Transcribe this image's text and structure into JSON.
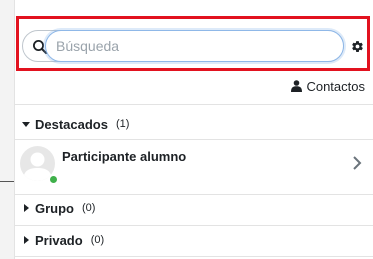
{
  "search": {
    "placeholder": "Búsqueda",
    "value": ""
  },
  "contacts_link": {
    "label": "Contactos",
    "icon": "user-icon"
  },
  "sections": [
    {
      "label": "Destacados",
      "count": "(1)",
      "expanded": true
    },
    {
      "label": "Grupo",
      "count": "(0)",
      "expanded": false
    },
    {
      "label": "Privado",
      "count": "(0)",
      "expanded": false
    }
  ],
  "starred_contacts": [
    {
      "name": "Participante alumno",
      "status": "online"
    }
  ],
  "colors": {
    "highlight": "#e2121f",
    "online": "#3fb04a",
    "focus_border": "#8fb8e8"
  },
  "icons": [
    "search-icon",
    "gear-icon",
    "user-icon",
    "caret-down-icon",
    "caret-right-icon",
    "chevron-right-icon",
    "avatar"
  ]
}
